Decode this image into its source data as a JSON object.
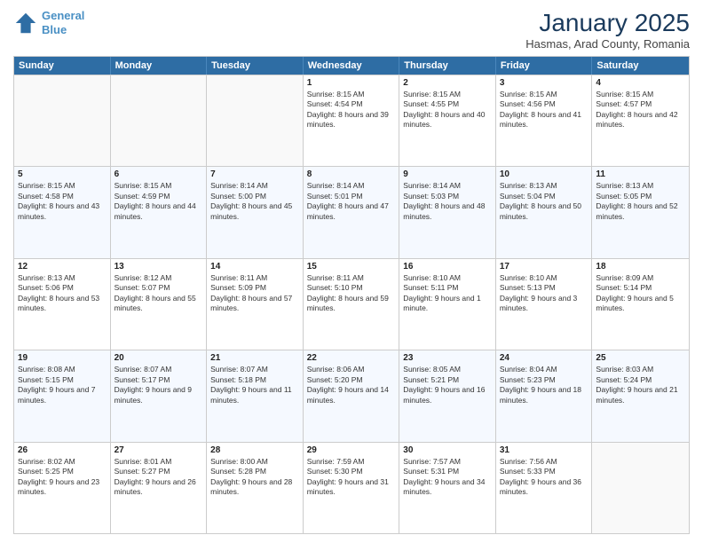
{
  "logo": {
    "line1": "General",
    "line2": "Blue"
  },
  "title": "January 2025",
  "subtitle": "Hasmas, Arad County, Romania",
  "days_of_week": [
    "Sunday",
    "Monday",
    "Tuesday",
    "Wednesday",
    "Thursday",
    "Friday",
    "Saturday"
  ],
  "weeks": [
    [
      {
        "day": "",
        "sunrise": "",
        "sunset": "",
        "daylight": ""
      },
      {
        "day": "",
        "sunrise": "",
        "sunset": "",
        "daylight": ""
      },
      {
        "day": "",
        "sunrise": "",
        "sunset": "",
        "daylight": ""
      },
      {
        "day": "1",
        "sunrise": "Sunrise: 8:15 AM",
        "sunset": "Sunset: 4:54 PM",
        "daylight": "Daylight: 8 hours and 39 minutes."
      },
      {
        "day": "2",
        "sunrise": "Sunrise: 8:15 AM",
        "sunset": "Sunset: 4:55 PM",
        "daylight": "Daylight: 8 hours and 40 minutes."
      },
      {
        "day": "3",
        "sunrise": "Sunrise: 8:15 AM",
        "sunset": "Sunset: 4:56 PM",
        "daylight": "Daylight: 8 hours and 41 minutes."
      },
      {
        "day": "4",
        "sunrise": "Sunrise: 8:15 AM",
        "sunset": "Sunset: 4:57 PM",
        "daylight": "Daylight: 8 hours and 42 minutes."
      }
    ],
    [
      {
        "day": "5",
        "sunrise": "Sunrise: 8:15 AM",
        "sunset": "Sunset: 4:58 PM",
        "daylight": "Daylight: 8 hours and 43 minutes."
      },
      {
        "day": "6",
        "sunrise": "Sunrise: 8:15 AM",
        "sunset": "Sunset: 4:59 PM",
        "daylight": "Daylight: 8 hours and 44 minutes."
      },
      {
        "day": "7",
        "sunrise": "Sunrise: 8:14 AM",
        "sunset": "Sunset: 5:00 PM",
        "daylight": "Daylight: 8 hours and 45 minutes."
      },
      {
        "day": "8",
        "sunrise": "Sunrise: 8:14 AM",
        "sunset": "Sunset: 5:01 PM",
        "daylight": "Daylight: 8 hours and 47 minutes."
      },
      {
        "day": "9",
        "sunrise": "Sunrise: 8:14 AM",
        "sunset": "Sunset: 5:03 PM",
        "daylight": "Daylight: 8 hours and 48 minutes."
      },
      {
        "day": "10",
        "sunrise": "Sunrise: 8:13 AM",
        "sunset": "Sunset: 5:04 PM",
        "daylight": "Daylight: 8 hours and 50 minutes."
      },
      {
        "day": "11",
        "sunrise": "Sunrise: 8:13 AM",
        "sunset": "Sunset: 5:05 PM",
        "daylight": "Daylight: 8 hours and 52 minutes."
      }
    ],
    [
      {
        "day": "12",
        "sunrise": "Sunrise: 8:13 AM",
        "sunset": "Sunset: 5:06 PM",
        "daylight": "Daylight: 8 hours and 53 minutes."
      },
      {
        "day": "13",
        "sunrise": "Sunrise: 8:12 AM",
        "sunset": "Sunset: 5:07 PM",
        "daylight": "Daylight: 8 hours and 55 minutes."
      },
      {
        "day": "14",
        "sunrise": "Sunrise: 8:11 AM",
        "sunset": "Sunset: 5:09 PM",
        "daylight": "Daylight: 8 hours and 57 minutes."
      },
      {
        "day": "15",
        "sunrise": "Sunrise: 8:11 AM",
        "sunset": "Sunset: 5:10 PM",
        "daylight": "Daylight: 8 hours and 59 minutes."
      },
      {
        "day": "16",
        "sunrise": "Sunrise: 8:10 AM",
        "sunset": "Sunset: 5:11 PM",
        "daylight": "Daylight: 9 hours and 1 minute."
      },
      {
        "day": "17",
        "sunrise": "Sunrise: 8:10 AM",
        "sunset": "Sunset: 5:13 PM",
        "daylight": "Daylight: 9 hours and 3 minutes."
      },
      {
        "day": "18",
        "sunrise": "Sunrise: 8:09 AM",
        "sunset": "Sunset: 5:14 PM",
        "daylight": "Daylight: 9 hours and 5 minutes."
      }
    ],
    [
      {
        "day": "19",
        "sunrise": "Sunrise: 8:08 AM",
        "sunset": "Sunset: 5:15 PM",
        "daylight": "Daylight: 9 hours and 7 minutes."
      },
      {
        "day": "20",
        "sunrise": "Sunrise: 8:07 AM",
        "sunset": "Sunset: 5:17 PM",
        "daylight": "Daylight: 9 hours and 9 minutes."
      },
      {
        "day": "21",
        "sunrise": "Sunrise: 8:07 AM",
        "sunset": "Sunset: 5:18 PM",
        "daylight": "Daylight: 9 hours and 11 minutes."
      },
      {
        "day": "22",
        "sunrise": "Sunrise: 8:06 AM",
        "sunset": "Sunset: 5:20 PM",
        "daylight": "Daylight: 9 hours and 14 minutes."
      },
      {
        "day": "23",
        "sunrise": "Sunrise: 8:05 AM",
        "sunset": "Sunset: 5:21 PM",
        "daylight": "Daylight: 9 hours and 16 minutes."
      },
      {
        "day": "24",
        "sunrise": "Sunrise: 8:04 AM",
        "sunset": "Sunset: 5:23 PM",
        "daylight": "Daylight: 9 hours and 18 minutes."
      },
      {
        "day": "25",
        "sunrise": "Sunrise: 8:03 AM",
        "sunset": "Sunset: 5:24 PM",
        "daylight": "Daylight: 9 hours and 21 minutes."
      }
    ],
    [
      {
        "day": "26",
        "sunrise": "Sunrise: 8:02 AM",
        "sunset": "Sunset: 5:25 PM",
        "daylight": "Daylight: 9 hours and 23 minutes."
      },
      {
        "day": "27",
        "sunrise": "Sunrise: 8:01 AM",
        "sunset": "Sunset: 5:27 PM",
        "daylight": "Daylight: 9 hours and 26 minutes."
      },
      {
        "day": "28",
        "sunrise": "Sunrise: 8:00 AM",
        "sunset": "Sunset: 5:28 PM",
        "daylight": "Daylight: 9 hours and 28 minutes."
      },
      {
        "day": "29",
        "sunrise": "Sunrise: 7:59 AM",
        "sunset": "Sunset: 5:30 PM",
        "daylight": "Daylight: 9 hours and 31 minutes."
      },
      {
        "day": "30",
        "sunrise": "Sunrise: 7:57 AM",
        "sunset": "Sunset: 5:31 PM",
        "daylight": "Daylight: 9 hours and 34 minutes."
      },
      {
        "day": "31",
        "sunrise": "Sunrise: 7:56 AM",
        "sunset": "Sunset: 5:33 PM",
        "daylight": "Daylight: 9 hours and 36 minutes."
      },
      {
        "day": "",
        "sunrise": "",
        "sunset": "",
        "daylight": ""
      }
    ]
  ]
}
